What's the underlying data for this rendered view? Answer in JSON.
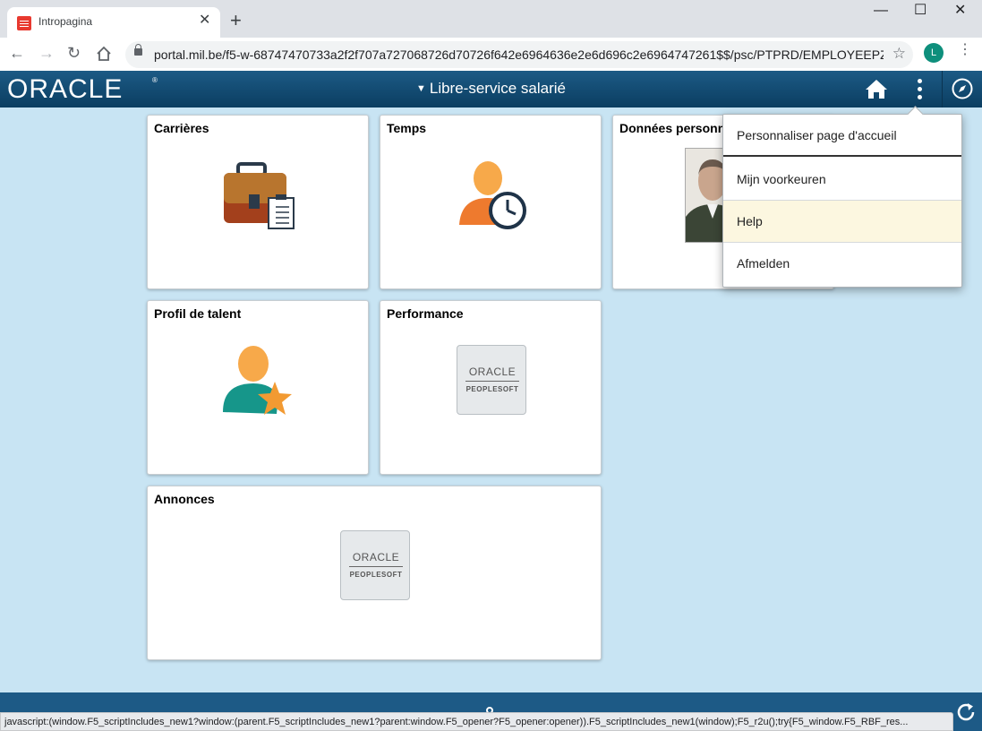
{
  "browser": {
    "tab_title": "Intropagina",
    "url": "portal.mil.be/f5-w-68747470733a2f2f707a727068726d70726f642e6964636e2e6d696c2e6964747261$$/psc/PTPRD/EMPLOYEEPZ/...",
    "profile_initial": "L",
    "status_text": "javascript:(window.F5_scriptIncludes_new1?window:(parent.F5_scriptIncludes_new1?parent:window.F5_opener?F5_opener:opener)).F5_scriptIncludes_new1(window);F5_r2u();try{F5_window.F5_RBF_res..."
  },
  "header": {
    "brand": "ORACLE",
    "brand_mark": "®",
    "title": "Libre-service salarié"
  },
  "tiles": {
    "carrieres": "Carrières",
    "temps": "Temps",
    "donnees": "Données personnelles",
    "profil": "Profil de talent",
    "performance": "Performance",
    "annonces": "Annonces"
  },
  "ps_logo": {
    "oracle": "ORACLE",
    "peoplesoft": "PEOPLESOFT"
  },
  "action_menu": {
    "items": [
      "Personnaliser page d'accueil",
      "Mijn voorkeuren",
      "Help",
      "Afmelden"
    ]
  },
  "colors": {
    "header": "#134a72",
    "background": "#c8e4f3",
    "menu_hover": "#fcf7e0"
  }
}
